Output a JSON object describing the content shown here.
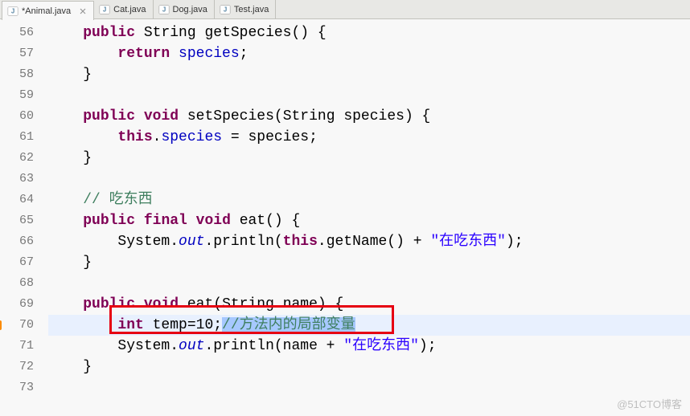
{
  "tabs": [
    {
      "label": "*Animal.java",
      "active": true,
      "closeable": true
    },
    {
      "label": "Cat.java",
      "active": false,
      "closeable": false
    },
    {
      "label": "Dog.java",
      "active": false,
      "closeable": false
    },
    {
      "label": "Test.java",
      "active": false,
      "closeable": false
    }
  ],
  "lineStart": 56,
  "code": {
    "l56": {
      "indent": "    ",
      "kw1": "public",
      "type": "String",
      "method": "getSpecies",
      "paren": "() {"
    },
    "l57": {
      "indent": "        ",
      "kw": "return",
      "field": "species",
      "semi": ";"
    },
    "l58": {
      "brace": "    }"
    },
    "l59": {
      "blank": ""
    },
    "l60": {
      "indent": "    ",
      "kw1": "public",
      "kw2": "void",
      "method": "setSpecies",
      "params_open": "(String ",
      "param": "species",
      "params_close": ") {"
    },
    "l61": {
      "indent": "        ",
      "kw": "this",
      "dot": ".",
      "field": "species",
      "assign": " = ",
      "var": "species",
      "semi": ";"
    },
    "l62": {
      "brace": "    }"
    },
    "l63": {
      "blank": ""
    },
    "l64": {
      "indent": "    ",
      "comment": "// 吃东西"
    },
    "l65": {
      "indent": "    ",
      "kw1": "public",
      "kw2": "final",
      "kw3": "void",
      "method": "eat",
      "paren": "() {"
    },
    "l66": {
      "indent": "        ",
      "obj": "System.",
      "staticf": "out",
      "call": ".println(",
      "kw": "this",
      "rest": ".getName() + ",
      "str": "\"在吃东西\"",
      "end": ");"
    },
    "l67": {
      "brace": "    }"
    },
    "l68": {
      "blank": ""
    },
    "l69": {
      "indent": "    ",
      "kw1": "public",
      "kw2": "void",
      "method": "eat",
      "params": "(String name) {"
    },
    "l70": {
      "indent": "        ",
      "kw": "int",
      "var": " temp=10;",
      "comment": "//方法内的局部变量"
    },
    "l71": {
      "indent": "        ",
      "obj": "System.",
      "staticf": "out",
      "call": ".println(name + ",
      "str": "\"在吃东西\"",
      "end": ");"
    },
    "l72": {
      "brace": "    }"
    },
    "l73": {
      "blank": ""
    }
  },
  "watermark": "@51CTO博客"
}
